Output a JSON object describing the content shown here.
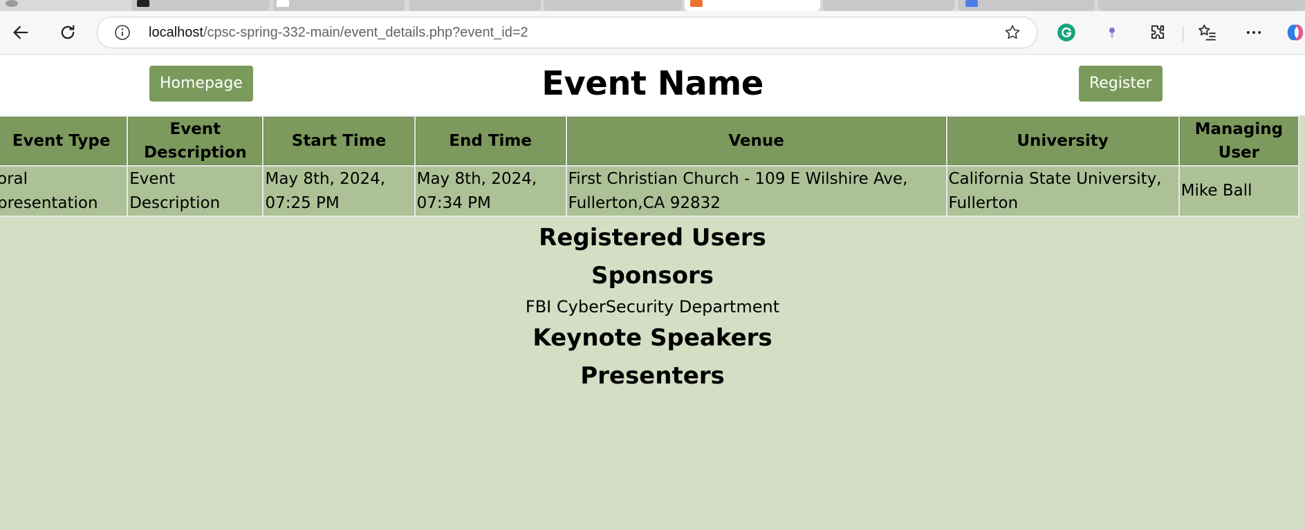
{
  "browser": {
    "url_host": "localhost",
    "url_path": "/cpsc-spring-332-main/event_details.php?event_id=2"
  },
  "header": {
    "title": "Event Name",
    "homepage_label": "Homepage",
    "register_label": "Register"
  },
  "table": {
    "columns": [
      "Event Type",
      "Event Description",
      "Start Time",
      "End Time",
      "Venue",
      "University",
      "Managing User"
    ],
    "row": {
      "event_type": "oral presentation",
      "description": "Event Description",
      "start_time": "May 8th, 2024, 07:25 PM",
      "end_time": "May 8th, 2024, 07:34 PM",
      "venue": "First Christian Church - 109 E Wilshire Ave, Fullerton,CA 92832",
      "university": "California State University, Fullerton",
      "managing_user": "Mike Ball"
    }
  },
  "sections": {
    "registered_users": "Registered Users",
    "sponsors": "Sponsors",
    "keynote_speakers": "Keynote Speakers",
    "presenters": "Presenters"
  },
  "sponsors": [
    "FBI CyberSecurity Department"
  ],
  "colors": {
    "button_green": "#7a9a5c",
    "header_cell_green": "#7c9a5d",
    "data_cell_green": "#adc196",
    "page_background": "#d4dec4"
  }
}
